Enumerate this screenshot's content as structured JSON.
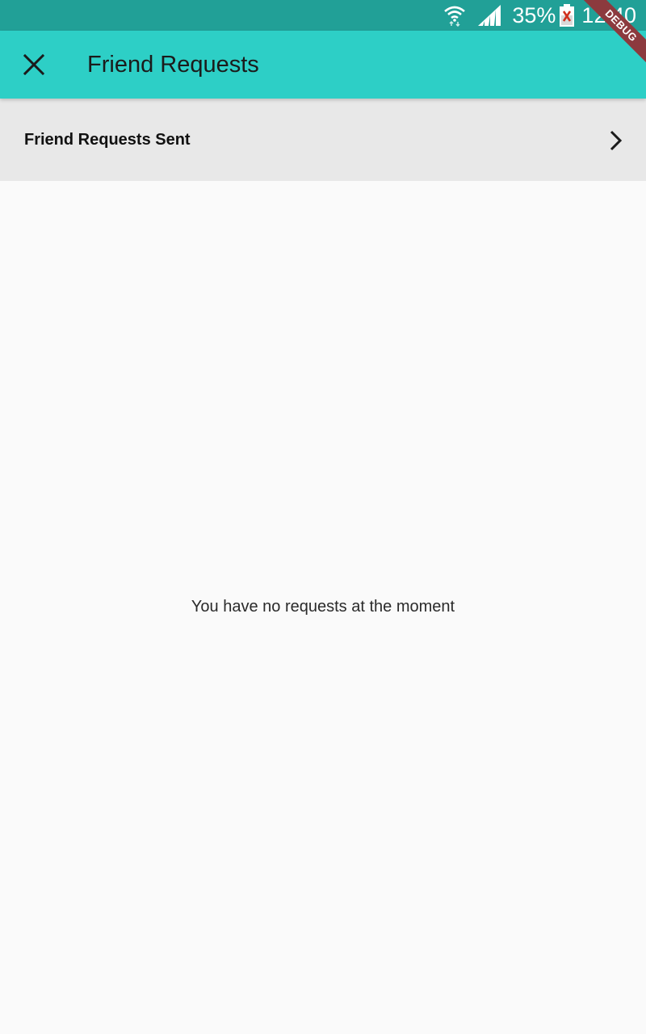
{
  "status_bar": {
    "battery_percent": "35%",
    "time": "12:40"
  },
  "app_bar": {
    "title": "Friend Requests",
    "close_icon": "close-icon"
  },
  "sent_row": {
    "label": "Friend Requests Sent",
    "icon": "chevron-right-icon"
  },
  "empty_state": {
    "message": "You have no requests at the moment"
  },
  "debug_banner": {
    "label": "DEBUG"
  },
  "colors": {
    "status_bar": "#21a097",
    "app_bar": "#2dcfc6",
    "row_background": "#e8e8e8",
    "page_background": "#fafafa",
    "debug_banner": "#8c3a3e"
  }
}
